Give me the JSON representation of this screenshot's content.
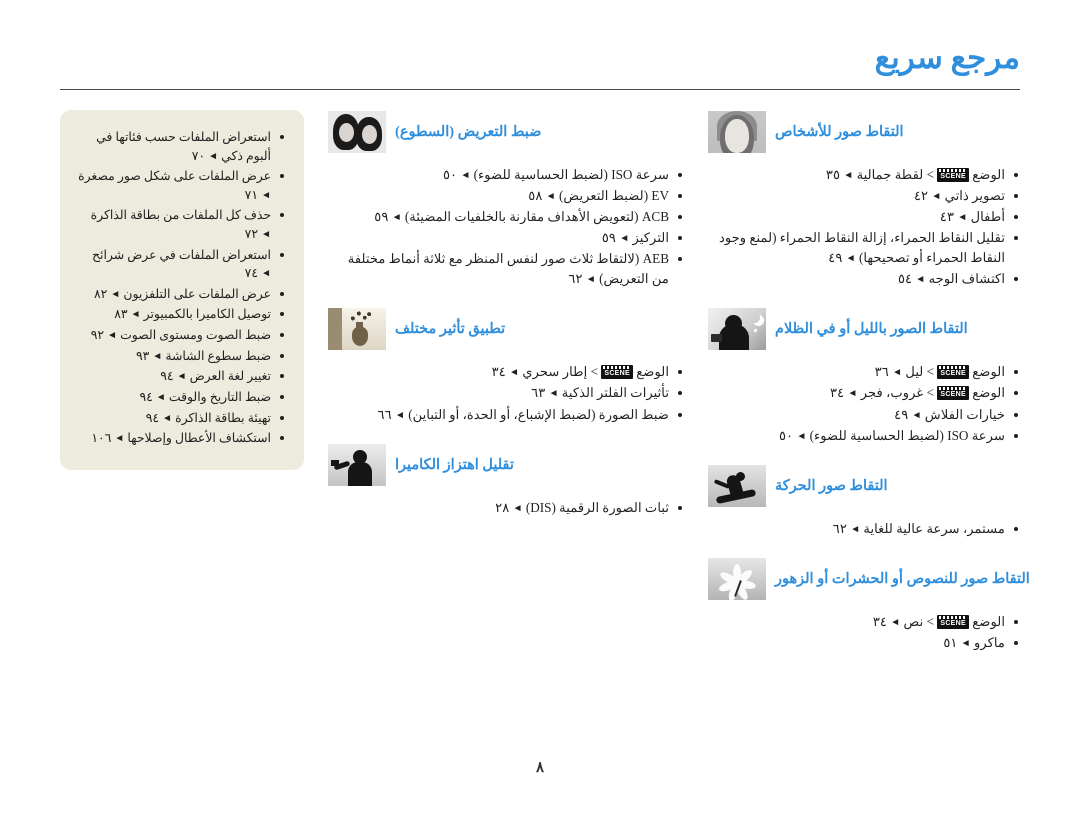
{
  "header": {
    "title": "مرجع سريع"
  },
  "footer": {
    "page_number": "٨"
  },
  "colors": {
    "accent": "#2f8fdc",
    "text": "#231f20",
    "tintbox_bg": "#edeade"
  },
  "columns": {
    "right": [
      {
        "id": "portrait",
        "title": "التقاط صور للأشخاص",
        "thumb": "portrait-thumb",
        "items": [
          {
            "text": "الوضع ",
            "scene": true,
            "text2": " > لقطة جمالية ",
            "page": "٣٥"
          },
          {
            "text": "تصوير ذاتي ",
            "page": "٤٢"
          },
          {
            "text": "أطفال ",
            "page": "٤٣"
          },
          {
            "text": "تقليل النقاط الحمراء، إزالة النقاط الحمراء (لمنع وجود النقاط الحمراء أو تصحيحها) ",
            "page": "٤٩"
          },
          {
            "text": "اكتشاف الوجه ",
            "page": "٥٤"
          }
        ]
      },
      {
        "id": "night",
        "title": "التقاط الصور بالليل أو في الظلام",
        "thumb": "night-thumb",
        "items": [
          {
            "text": "الوضع ",
            "scene": true,
            "text2": " > ليل ",
            "page": "٣٦"
          },
          {
            "text": "الوضع ",
            "scene": true,
            "text2": " > غروب، فجر ",
            "page": "٣٤"
          },
          {
            "text": "خيارات الفلاش ",
            "page": "٤٩"
          },
          {
            "text": "سرعة ISO (لضبط الحساسية للضوء) ",
            "page": "٥٠"
          }
        ]
      },
      {
        "id": "action",
        "title": "التقاط صور الحركة",
        "thumb": "sport-thumb",
        "items": [
          {
            "text": "مستمر، سرعة عالية للغاية ",
            "page": "٦٢"
          }
        ]
      },
      {
        "id": "macro",
        "title": "التقاط صور للنصوص أو الحشرات أو الزهور",
        "thumb": "macro-thumb",
        "items": [
          {
            "text": "الوضع ",
            "scene": true,
            "text2": " > نص ",
            "page": "٣٤"
          },
          {
            "text": "ماكرو ",
            "page": "٥١"
          }
        ]
      }
    ],
    "middle": [
      {
        "id": "exposure",
        "title": "ضبط التعريض (السطوع)",
        "thumb": "two-people-thumb",
        "items": [
          {
            "text": "سرعة ISO (لضبط الحساسية للضوء) ",
            "page": "٥٠"
          },
          {
            "text": "EV (لضبط التعريض) ",
            "page": "٥٨"
          },
          {
            "text": "ACB (لتعويض الأهداف مقارنة بالخلفيات المضيئة) ",
            "page": "٥٩"
          },
          {
            "text": "التركيز ",
            "page": "٥٩"
          },
          {
            "text": "AEB (لالتقاط ثلاث صور لنفس المنظر مع ثلاثة أنماط مختلفة من التعريض) ",
            "page": "٦٢"
          }
        ]
      },
      {
        "id": "effects",
        "title": "تطبيق تأثير مختلف",
        "thumb": "still-life-thumb",
        "items": [
          {
            "text": "الوضع ",
            "scene": true,
            "text2": " > إطار سحري ",
            "page": "٣٤"
          },
          {
            "text": "تأثيرات الفلتر الذكية ",
            "page": "٦٣"
          },
          {
            "text": "ضبط الصورة (لضبط الإشباع، أو الحدة، أو التباين) ",
            "page": "٦٦"
          }
        ]
      },
      {
        "id": "shake",
        "title": "تقليل اهتزاز الكاميرا",
        "thumb": "shake-thumb",
        "items": [
          {
            "text": "ثبات الصورة الرقمية (DIS) ",
            "page": "٢٨"
          }
        ]
      }
    ],
    "left_box": {
      "items": [
        {
          "text": "استعراض الملفات حسب فئاتها في ألبوم ذكي ",
          "page": "٧٠"
        },
        {
          "text": "عرض الملفات على شكل صور مصغرة ",
          "page": "٧١"
        },
        {
          "text": "حذف كل الملفات من بطاقة الذاكرة ",
          "page": "٧٢"
        },
        {
          "text": "استعراض الملفات في عرض شرائح ",
          "page": "٧٤"
        },
        {
          "text": "عرض الملفات على التلفزيون ",
          "page": "٨٢"
        },
        {
          "text": "توصيل الكاميرا بالكمبيوتر ",
          "page": "٨٣"
        },
        {
          "text": "ضبط الصوت ومستوى الصوت ",
          "page": "٩٢"
        },
        {
          "text": "ضبط سطوع الشاشة ",
          "page": "٩٣"
        },
        {
          "text": "تغيير لغة العرض ",
          "page": "٩٤"
        },
        {
          "text": "ضبط التاريخ والوقت ",
          "page": "٩٤"
        },
        {
          "text": "تهيئة بطاقة الذاكرة ",
          "page": "٩٤"
        },
        {
          "text": "استكشاف الأعطال وإصلاحها ",
          "page": "١٠٦"
        }
      ]
    }
  },
  "scene_chip_label": "SCENE",
  "arrow_glyph": "◄"
}
